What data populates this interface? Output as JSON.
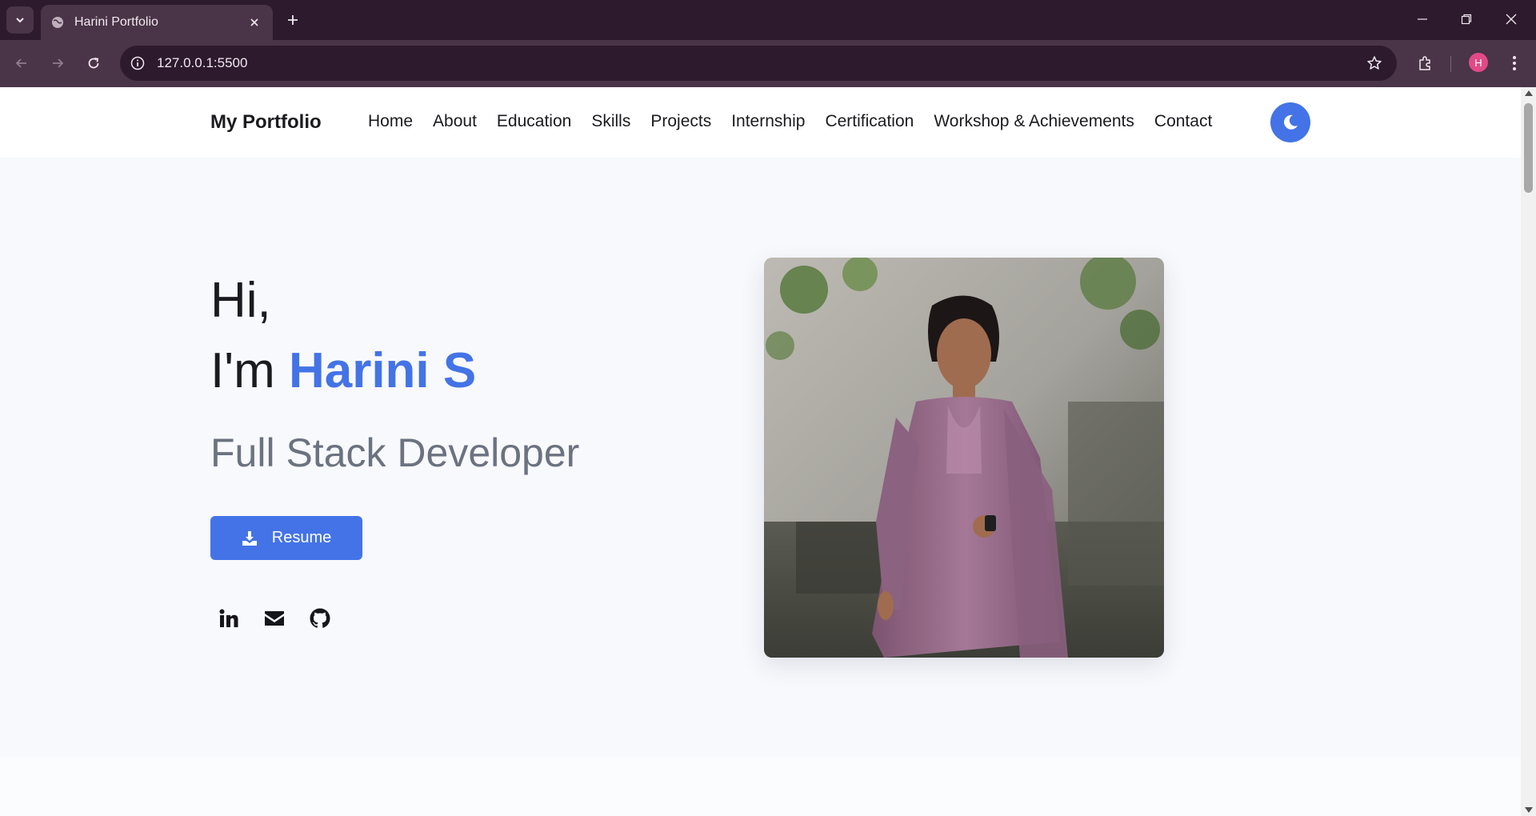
{
  "browser": {
    "tab_title": "Harini Portfolio",
    "url": "127.0.0.1:5500",
    "profile_initial": "H"
  },
  "navbar": {
    "brand": "My Portfolio",
    "links": [
      "Home",
      "About",
      "Education",
      "Skills",
      "Projects",
      "Internship",
      "Certification",
      "Workshop & Achievements",
      "Contact"
    ],
    "theme_toggle_icon": "moon-icon"
  },
  "hero": {
    "greeting": "Hi,",
    "intro_prefix": "I'm ",
    "name": "Harini S",
    "role": "Full Stack Developer",
    "resume_label": "Resume",
    "socials": [
      "linkedin-icon",
      "email-icon",
      "github-icon"
    ]
  },
  "colors": {
    "accent": "#4373e6",
    "chrome_dark": "#2d1a2d",
    "chrome_toolbar": "#4a3447",
    "page_bg": "#f8f9fc",
    "text": "#1b1b1f",
    "muted": "#6b7280"
  }
}
